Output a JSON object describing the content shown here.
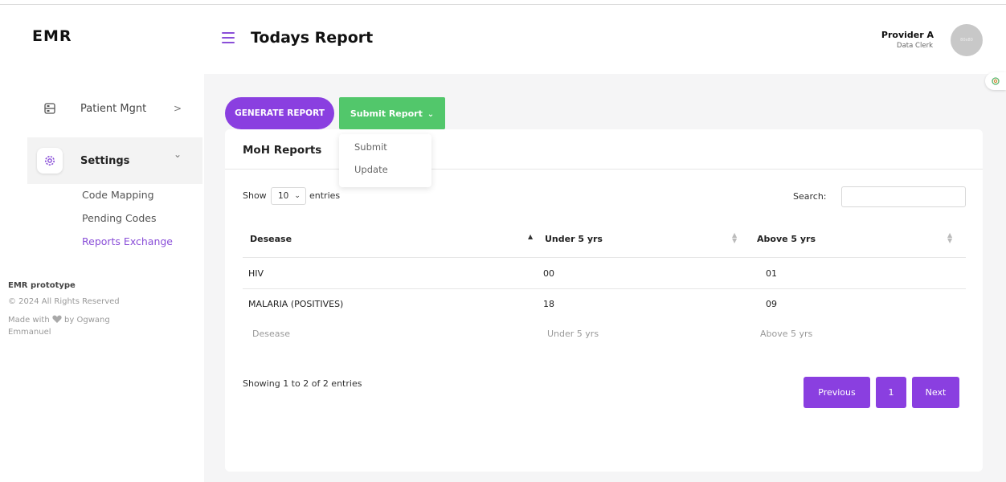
{
  "app": {
    "logo": "EMR"
  },
  "header": {
    "title": "Todays Report",
    "provider_name": "Provider A",
    "provider_role": "Data Clerk",
    "avatar_text": "80x80"
  },
  "sidebar": {
    "items": [
      {
        "label": "Patient Mgnt",
        "icon": "grid-icon",
        "chevron": ">"
      },
      {
        "label": "Settings",
        "icon": "gear-icon",
        "chevron": "⌄"
      }
    ],
    "subitems": [
      {
        "label": "Code Mapping"
      },
      {
        "label": "Pending Codes"
      },
      {
        "label": "Reports Exchange"
      }
    ],
    "footer": {
      "title": "EMR prototype",
      "copyright": "© 2024 All Rights Reserved",
      "made_prefix": "Made with",
      "made_suffix": "by Ogwang",
      "made_name": "Emmanuel"
    }
  },
  "toolbar": {
    "generate_label": "GENERATE REPORT",
    "submit_label": "Submit Report",
    "dropdown": [
      "Submit",
      "Update"
    ]
  },
  "card": {
    "title": "MoH Reports",
    "show_label": "Show",
    "entries_value": "10",
    "entries_label": "entries",
    "search_label": "Search:",
    "search_value": ""
  },
  "table": {
    "headers": [
      "Desease",
      "Under 5 yrs",
      "Above 5 yrs"
    ],
    "rows": [
      [
        "HIV",
        "00",
        "01"
      ],
      [
        "MALARIA (POSITIVES)",
        "18",
        "09"
      ]
    ],
    "footer": [
      "Desease",
      "Under 5 yrs",
      "Above 5 yrs"
    ],
    "info": "Showing 1 to 2 of 2 entries"
  },
  "pagination": {
    "previous": "Previous",
    "page": "1",
    "next": "Next"
  },
  "colors": {
    "accent": "#8a3fe0",
    "success": "#52c76b",
    "active_link": "#8a4fd8"
  }
}
